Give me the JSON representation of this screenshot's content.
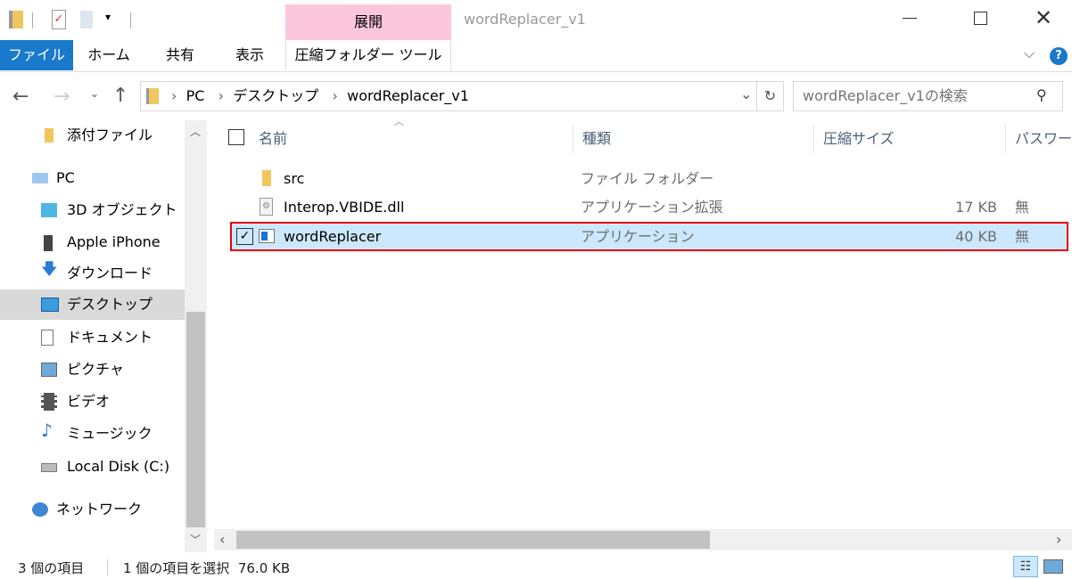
{
  "window": {
    "title": "wordReplacer_v1",
    "minimize_icon": "minimize-icon",
    "maximize_icon": "maximize-icon",
    "close_icon": "close-icon"
  },
  "ribbon": {
    "context_group": "展開",
    "tabs": [
      "ファイル",
      "ホーム",
      "共有",
      "表示",
      "圧縮フォルダー ツール"
    ],
    "accent": "#1979ca",
    "context_color": "#fcc6dd"
  },
  "address": {
    "breadcrumb": [
      "PC",
      "デスクトップ",
      "wordReplacer_v1"
    ],
    "search_placeholder": "wordReplacer_v1の検索"
  },
  "nav": {
    "items": [
      {
        "label": "添付ファイル",
        "icon": "folder-icon"
      },
      {
        "label": "PC",
        "icon": "pc-icon"
      },
      {
        "label": "3D オブジェクト",
        "icon": "3d-objects-icon"
      },
      {
        "label": "Apple iPhone",
        "icon": "phone-icon"
      },
      {
        "label": "ダウンロード",
        "icon": "download-icon"
      },
      {
        "label": "デスクトップ",
        "icon": "desktop-icon",
        "selected": true
      },
      {
        "label": "ドキュメント",
        "icon": "document-icon"
      },
      {
        "label": "ピクチャ",
        "icon": "pictures-icon"
      },
      {
        "label": "ビデオ",
        "icon": "video-icon"
      },
      {
        "label": "ミュージック",
        "icon": "music-icon"
      },
      {
        "label": "Local Disk (C:)",
        "icon": "disk-icon"
      },
      {
        "label": "ネットワーク",
        "icon": "network-icon"
      }
    ]
  },
  "columns": [
    "名前",
    "種類",
    "圧縮サイズ",
    "パスワード"
  ],
  "files": [
    {
      "name": "src",
      "type": "ファイル フォルダー",
      "size": "",
      "password": "",
      "icon": "folder-icon"
    },
    {
      "name": "Interop.VBIDE.dll",
      "type": "アプリケーション拡張",
      "size": "17 KB",
      "password": "無",
      "icon": "dll-icon"
    },
    {
      "name": "wordReplacer",
      "type": "アプリケーション",
      "size": "40 KB",
      "password": "無",
      "icon": "application-icon",
      "selected": true,
      "checked": true
    }
  ],
  "status": {
    "count": "3 個の項目",
    "selection": "1 個の項目を選択  76.0 KB"
  }
}
